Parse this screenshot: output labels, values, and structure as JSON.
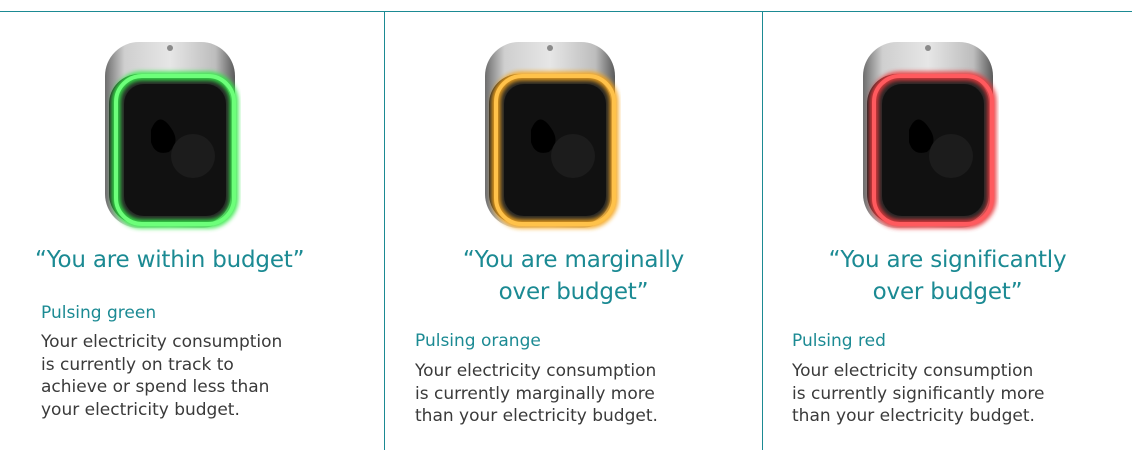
{
  "colors": {
    "accent": "#1b8a93",
    "text": "#3a3a3a",
    "green_ring": "#35e84a",
    "orange_ring": "#f4a51c",
    "red_ring": "#e83a3e"
  },
  "panels": [
    {
      "heading": "“You are within budget”",
      "subheading": "Pulsing green",
      "body_lines": [
        "Your electricity consumption",
        "is currently on track to",
        "achieve or spend less than",
        "your electricity budget."
      ],
      "device_icon": "energy-monitor-green-icon"
    },
    {
      "heading_lines": [
        "“You are marginally",
        "over budget”"
      ],
      "subheading": "Pulsing orange",
      "body_lines": [
        "Your electricity consumption",
        "is currently marginally more",
        "than your electricity budget."
      ],
      "device_icon": "energy-monitor-orange-icon"
    },
    {
      "heading_lines": [
        "“You are significantly",
        "over budget”"
      ],
      "subheading": "Pulsing red",
      "body_lines": [
        "Your electricity consumption",
        "is currently significantly more",
        "than your electricity budget."
      ],
      "device_icon": "energy-monitor-red-icon"
    }
  ]
}
